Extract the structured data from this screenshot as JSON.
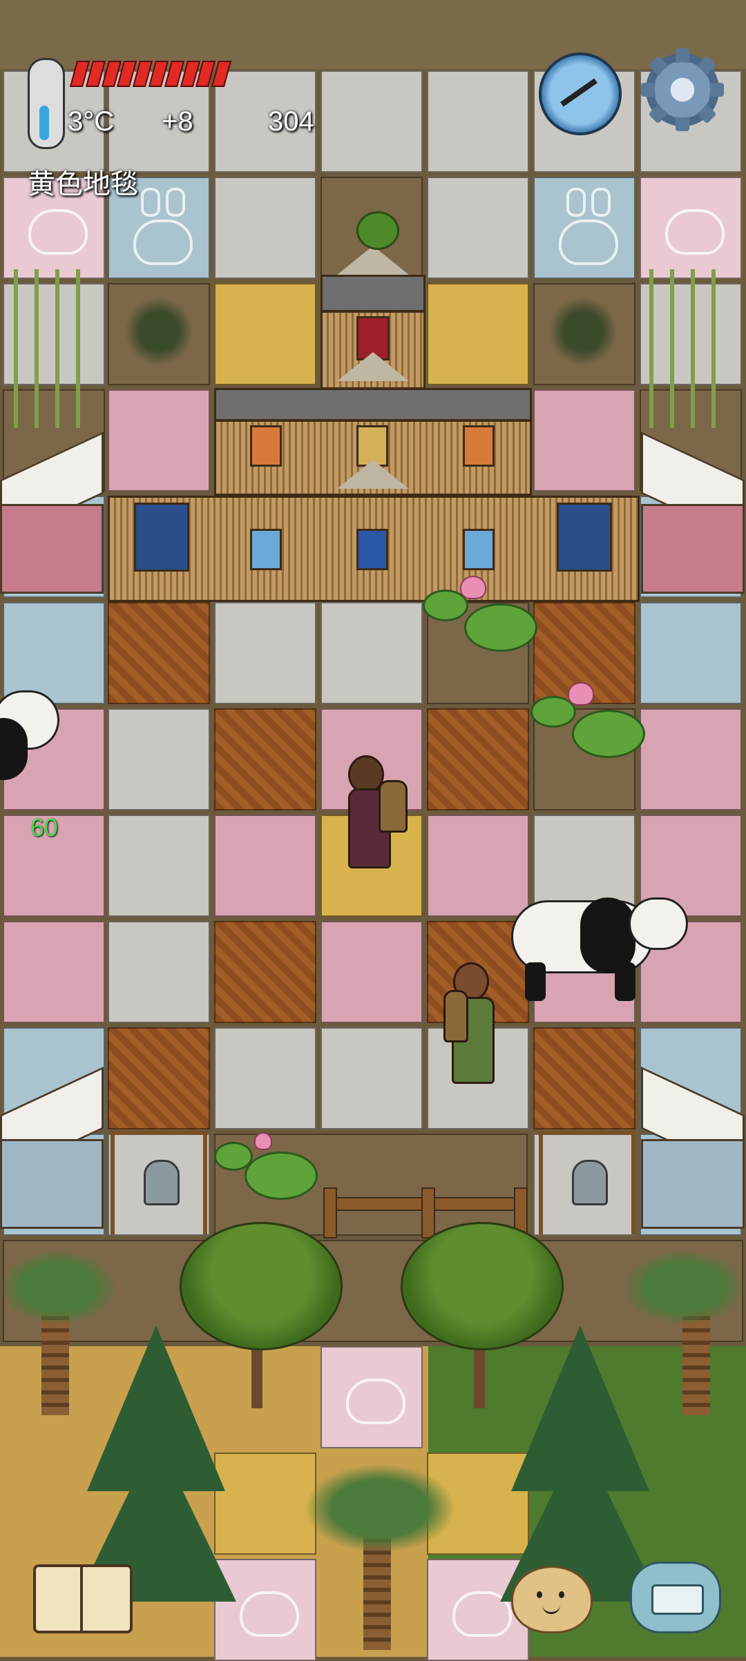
{
  "hud": {
    "temperature": "3°C",
    "temperature_delta": "+8",
    "score": "304",
    "held_item": "黄色地毯",
    "fps": "60",
    "health_fraction": 1.0
  },
  "controls": {
    "compass_icon": "compass-icon",
    "settings_icon": "gear-icon",
    "recipe_book_icon": "book-icon",
    "emote_icon": "potato-face-icon",
    "chat_icon": "keyboard-icon"
  },
  "colors": {
    "health": "#e02a24",
    "fps_text": "#48d848",
    "hud_text": "#ffffff"
  }
}
